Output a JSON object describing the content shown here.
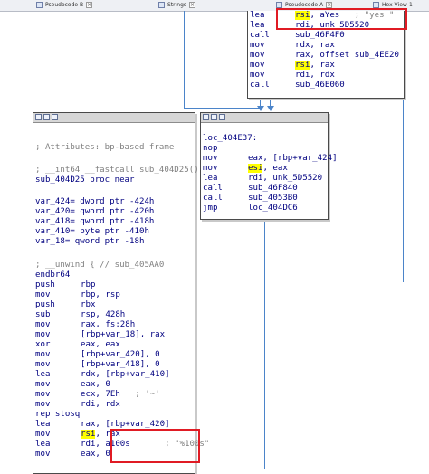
{
  "tabs": [
    {
      "label": "Pseudocode-B"
    },
    {
      "label": "Strings"
    },
    {
      "label": "Pseudocode-A"
    },
    {
      "label": "Hex View-1"
    }
  ],
  "top_block": {
    "lines": [
      {
        "op": "lea",
        "pre": "",
        "hl": "rsi",
        "post": ", aYes",
        "comment": "; \"yes \""
      },
      {
        "op": "lea",
        "pre": "rdi, unk_5D5520",
        "hl": "",
        "post": "",
        "comment": ""
      },
      {
        "op": "call",
        "pre": "sub_46F4F0",
        "hl": "",
        "post": "",
        "comment": ""
      },
      {
        "op": "mov",
        "pre": "rdx, rax",
        "hl": "",
        "post": "",
        "comment": ""
      },
      {
        "op": "mov",
        "pre": "rax, offset sub_4EE20",
        "hl": "",
        "post": "",
        "comment": ""
      },
      {
        "op": "mov",
        "pre": "",
        "hl": "rsi",
        "post": ", rax",
        "comment": ""
      },
      {
        "op": "mov",
        "pre": "rdi, rdx",
        "hl": "",
        "post": "",
        "comment": ""
      },
      {
        "op": "call",
        "pre": "sub_46E060",
        "hl": "",
        "post": "",
        "comment": ""
      }
    ]
  },
  "right_block": {
    "lines": [
      {
        "op": "",
        "pre": "",
        "hl": "",
        "post": "",
        "comment": ""
      },
      {
        "op": "loc_404E37:",
        "pre": "",
        "hl": "",
        "post": "",
        "comment": ""
      },
      {
        "op": "nop",
        "pre": "",
        "hl": "",
        "post": "",
        "comment": ""
      },
      {
        "op": "mov",
        "pre": "eax, [rbp+var_424]",
        "hl": "",
        "post": "",
        "comment": ""
      },
      {
        "op": "mov",
        "pre": "",
        "hl": "esi",
        "post": ", eax",
        "comment": ""
      },
      {
        "op": "lea",
        "pre": "rdi, unk_5D5520",
        "hl": "",
        "post": "",
        "comment": ""
      },
      {
        "op": "call",
        "pre": "sub_46F840",
        "hl": "",
        "post": "",
        "comment": ""
      },
      {
        "op": "call",
        "pre": "sub_4053B0",
        "hl": "",
        "post": "",
        "comment": ""
      },
      {
        "op": "jmp",
        "pre": "loc_404DC6",
        "hl": "",
        "post": "",
        "comment": ""
      }
    ]
  },
  "main_block": {
    "lines": [
      {
        "op": "",
        "pre": "",
        "hl": "",
        "post": "",
        "comment": ""
      },
      {
        "op": "",
        "pre": "",
        "hl": "",
        "post": "",
        "comment": ""
      },
      {
        "op": "",
        "pre": "",
        "hl": "",
        "post": "",
        "comment": "; Attributes: bp-based frame"
      },
      {
        "op": "",
        "pre": "",
        "hl": "",
        "post": "",
        "comment": ""
      },
      {
        "op": "",
        "pre": "",
        "hl": "",
        "post": "",
        "comment": "; __int64 __fastcall sub_404D25()"
      },
      {
        "op": "sub_404D25 proc near",
        "pre": "",
        "hl": "",
        "post": "",
        "comment": ""
      },
      {
        "op": "",
        "pre": "",
        "hl": "",
        "post": "",
        "comment": ""
      },
      {
        "op": "var_424= dword ptr -424h",
        "pre": "",
        "hl": "",
        "post": "",
        "comment": ""
      },
      {
        "op": "var_420= qword ptr -420h",
        "pre": "",
        "hl": "",
        "post": "",
        "comment": ""
      },
      {
        "op": "var_418= qword ptr -418h",
        "pre": "",
        "hl": "",
        "post": "",
        "comment": ""
      },
      {
        "op": "var_410= byte ptr -410h",
        "pre": "",
        "hl": "",
        "post": "",
        "comment": ""
      },
      {
        "op": "var_18= qword ptr -18h",
        "pre": "",
        "hl": "",
        "post": "",
        "comment": ""
      },
      {
        "op": "",
        "pre": "",
        "hl": "",
        "post": "",
        "comment": ""
      },
      {
        "op": "",
        "pre": "",
        "hl": "",
        "post": "",
        "comment": "; __unwind { // sub_405AA0"
      },
      {
        "op": "endbr64",
        "pre": "",
        "hl": "",
        "post": "",
        "comment": ""
      },
      {
        "op": "push",
        "pre": "rbp",
        "hl": "",
        "post": "",
        "comment": ""
      },
      {
        "op": "mov",
        "pre": "rbp, rsp",
        "hl": "",
        "post": "",
        "comment": ""
      },
      {
        "op": "push",
        "pre": "rbx",
        "hl": "",
        "post": "",
        "comment": ""
      },
      {
        "op": "sub",
        "pre": "rsp, 428h",
        "hl": "",
        "post": "",
        "comment": ""
      },
      {
        "op": "mov",
        "pre": "rax, fs:28h",
        "hl": "",
        "post": "",
        "comment": ""
      },
      {
        "op": "mov",
        "pre": "[rbp+var_18], rax",
        "hl": "",
        "post": "",
        "comment": ""
      },
      {
        "op": "xor",
        "pre": "eax, eax",
        "hl": "",
        "post": "",
        "comment": ""
      },
      {
        "op": "mov",
        "pre": "[rbp+var_420], 0",
        "hl": "",
        "post": "",
        "comment": ""
      },
      {
        "op": "mov",
        "pre": "[rbp+var_418], 0",
        "hl": "",
        "post": "",
        "comment": ""
      },
      {
        "op": "lea",
        "pre": "rdx, [rbp+var_410]",
        "hl": "",
        "post": "",
        "comment": ""
      },
      {
        "op": "mov",
        "pre": "eax, 0",
        "hl": "",
        "post": "",
        "comment": ""
      },
      {
        "op": "mov",
        "pre": "ecx, 7Eh",
        "hl": "",
        "post": "",
        "comment": "; '~'"
      },
      {
        "op": "mov",
        "pre": "rdi, rdx",
        "hl": "",
        "post": "",
        "comment": ""
      },
      {
        "op": "rep stosq",
        "pre": "",
        "hl": "",
        "post": "",
        "comment": ""
      },
      {
        "op": "lea",
        "pre": "rax, [rbp+var_420]",
        "hl": "",
        "post": "",
        "comment": ""
      },
      {
        "op": "mov",
        "pre": "",
        "hl": "rsi",
        "post": ", rax",
        "comment": ""
      },
      {
        "op": "lea",
        "pre": "rdi, a100s",
        "hl": "",
        "post": "",
        "comment": "; \"%100s\""
      },
      {
        "op": "mov",
        "pre": "eax, 0",
        "hl": "",
        "post": "",
        "comment": ""
      }
    ]
  },
  "colors": {
    "edge_blue": "#4b84c9",
    "highlight": "#ffff00",
    "annotation_red": "#e01b24",
    "code_blue": "#000080",
    "comment_gray": "#808080"
  }
}
